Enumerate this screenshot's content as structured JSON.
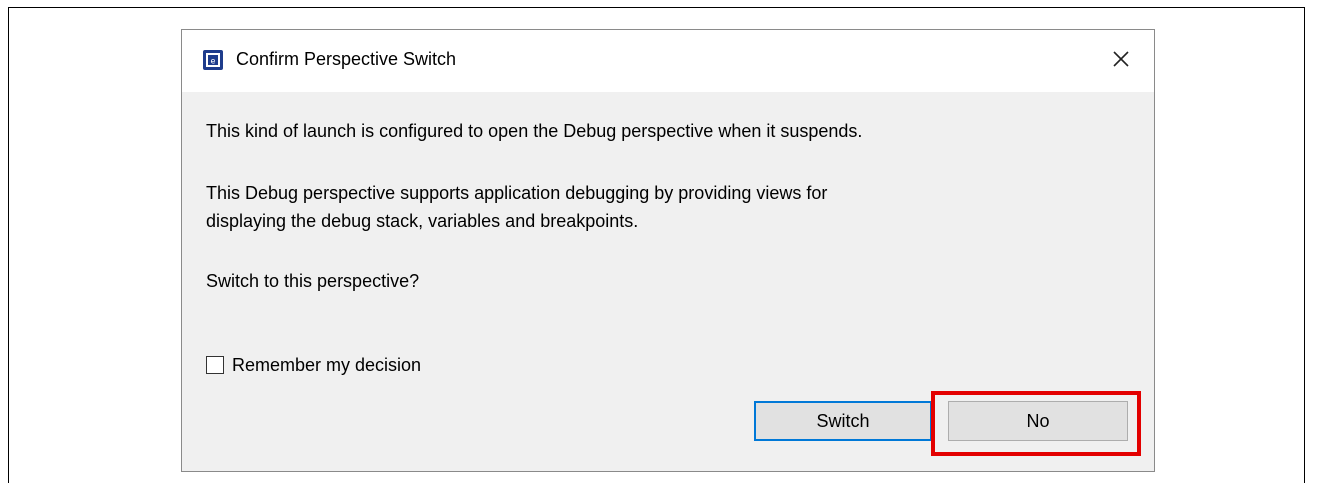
{
  "dialog": {
    "title": "Confirm Perspective Switch",
    "app_icon": "eclipse-e2-icon",
    "close_icon": "close-icon",
    "message_line1": "This kind of launch is configured to open the Debug perspective when it suspends.",
    "message_line2a": "This Debug perspective supports application debugging by providing views for",
    "message_line2b": "displaying the debug stack, variables and breakpoints.",
    "message_line3": "Switch to this perspective?",
    "checkbox_label": "Remember my decision",
    "checkbox_checked": false,
    "switch_label": "Switch",
    "no_label": "No"
  },
  "colors": {
    "highlight": "#e30000",
    "default_button_border": "#0078d7"
  }
}
